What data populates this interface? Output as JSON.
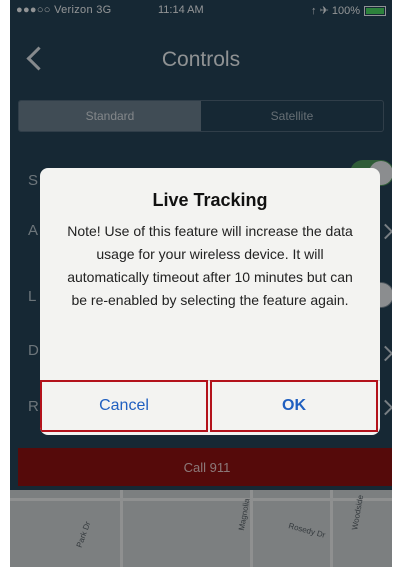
{
  "status_bar": {
    "carrier": "●●●○○ Verizon  3G",
    "time": "11:14 AM",
    "right": "↑ ✈ 100%"
  },
  "nav": {
    "title": "Controls"
  },
  "segmented": {
    "options": [
      "Standard",
      "Satellite"
    ],
    "selected": "Standard"
  },
  "background_rows": {
    "row1_char": "S",
    "row2_char": "A",
    "row3_char": "L",
    "row4_char": "D",
    "row5_char": "R"
  },
  "call_button": {
    "label": "Call 911",
    "color": "#8e1212"
  },
  "map": {
    "labels": [
      "Park Dr",
      "Rosedy Dr",
      "Magnolia",
      "Woodside"
    ]
  },
  "alert": {
    "title": "Live Tracking",
    "message": "Note! Use of this feature will increase the data usage for your wireless device. It will automatically timeout after 10 minutes but can be re-enabled by selecting the feature again.",
    "cancel_label": "Cancel",
    "ok_label": "OK",
    "highlight_color": "#b3121b",
    "button_text_color": "#1f5fc0"
  }
}
